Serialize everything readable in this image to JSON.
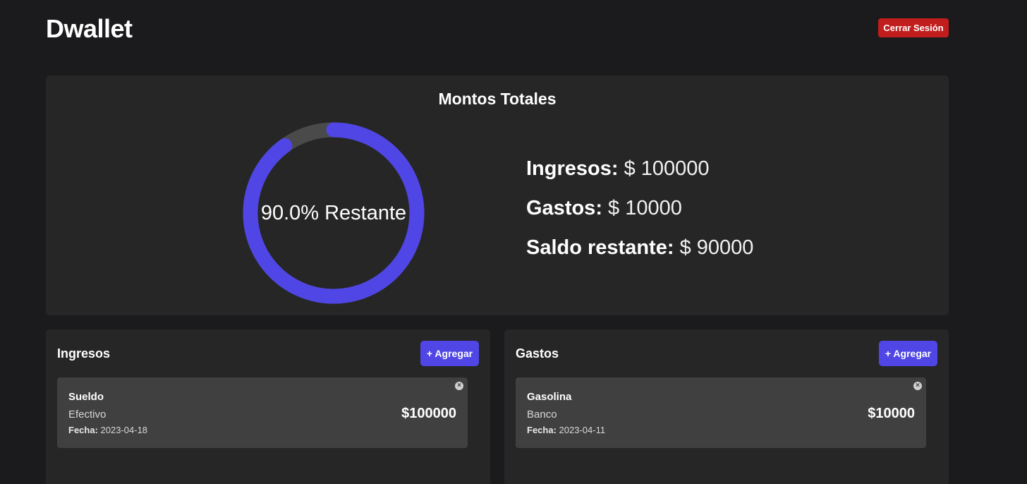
{
  "header": {
    "brand": "Dwallet",
    "logout_label": "Cerrar Sesión"
  },
  "totals": {
    "title": "Montos Totales",
    "remaining_fraction": 0.9,
    "donut_label": "90.0% Restante",
    "colors": {
      "remaining": "#4f46e5",
      "spent": "#4a4a4a"
    },
    "rows": [
      {
        "label": "Ingresos:",
        "value": "$ 100000"
      },
      {
        "label": "Gastos:",
        "value": "$ 10000"
      },
      {
        "label": "Saldo restante:",
        "value": "$ 90000"
      }
    ]
  },
  "ingresos": {
    "title": "Ingresos",
    "add_label": "+ Agregar",
    "items": [
      {
        "name": "Sueldo",
        "method": "Efectivo",
        "date_key": "Fecha:",
        "date": "2023-04-18",
        "amount": "$100000",
        "close_icon": "close-icon"
      }
    ]
  },
  "gastos": {
    "title": "Gastos",
    "add_label": "+ Agregar",
    "items": [
      {
        "name": "Gasolina",
        "method": "Banco",
        "date_key": "Fecha:",
        "date": "2023-04-11",
        "amount": "$10000",
        "close_icon": "close-icon"
      }
    ]
  }
}
